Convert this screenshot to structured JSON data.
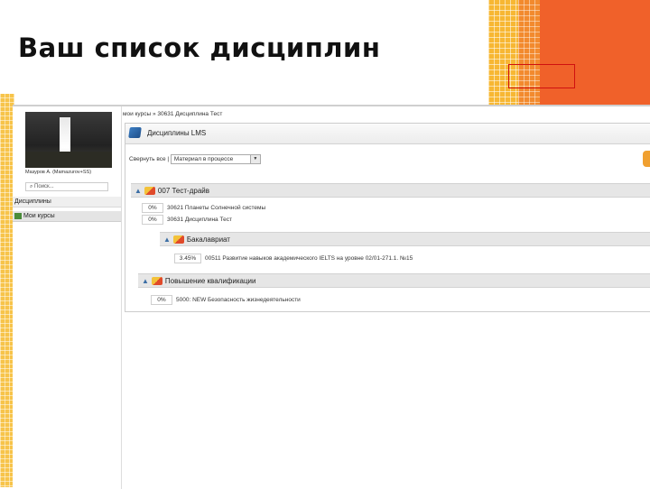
{
  "slide": {
    "title": "Ваш список дисциплин"
  },
  "sidebar": {
    "user_name": "Мазуров А. (Mamazurov+SS)",
    "search_placeholder": "Поиск...",
    "menu_disciplines": "Дисциплины",
    "menu_my_courses": "Мои курсы"
  },
  "breadcrumb": {
    "text": "мои курсы » 30631 Дисциплина Тест"
  },
  "panel": {
    "title": "Дисциплины LMS",
    "collapse_label": "Свернуть все |",
    "filter_value": "Материал в процессе"
  },
  "groups": [
    {
      "title": "007 Тест-драйв",
      "rows": [
        {
          "pct": "0%",
          "text": "30621 Планеты Солнечной системы"
        },
        {
          "pct": "0%",
          "text": "30631 Дисциплина Тест"
        }
      ]
    },
    {
      "title": "Бакалавриат",
      "rows": [
        {
          "pct": "3.45%",
          "text": "00511 Развитие навыков академического IELTS на уровне 02/01-271.1. №15"
        }
      ]
    },
    {
      "title": "Повышение квалификации",
      "rows": [
        {
          "pct": "0%",
          "text": "5000: NEW Безопасность жизнедеятельности"
        }
      ]
    }
  ],
  "colors": {
    "accent_orange": "#f0612a",
    "accent_yellow": "#f7b733",
    "header_gray": "#e6e6e6",
    "caret_blue": "#3b6ea5"
  }
}
